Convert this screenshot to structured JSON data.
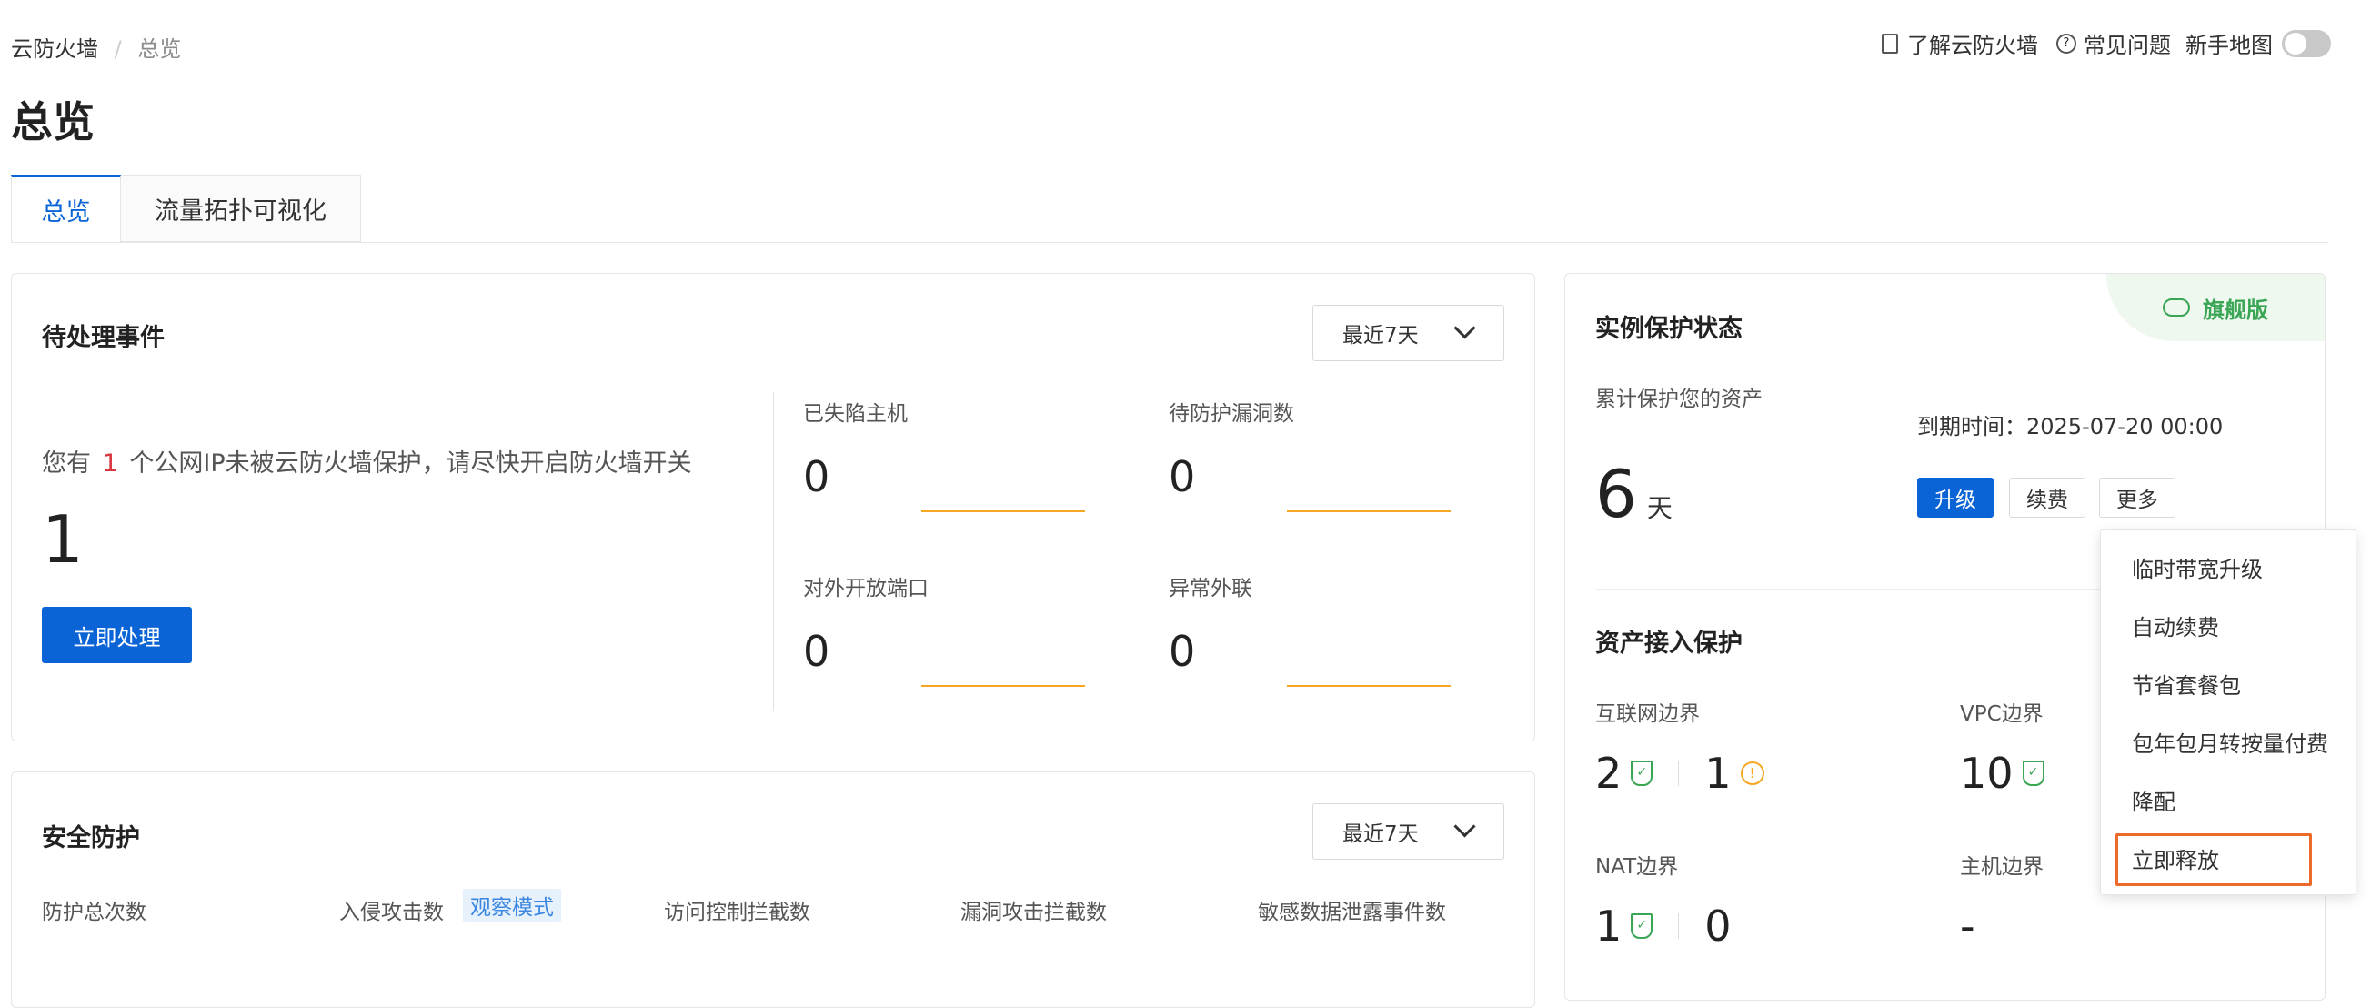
{
  "breadcrumb": {
    "root": "云防火墙",
    "separator": "/",
    "current": "总览"
  },
  "header_links": {
    "learn": "了解云防火墙",
    "faq": "常见问题",
    "guide": "新手地图",
    "guide_toggle_on": false
  },
  "page_title": "总览",
  "tabs": [
    {
      "label": "总览",
      "active": true
    },
    {
      "label": "流量拓扑可视化",
      "active": false
    }
  ],
  "pending": {
    "title": "待处理事件",
    "range": "最近7天",
    "message_prefix": "您有",
    "message_count": "1",
    "message_suffix": "个公网IP未被云防火墙保护，请尽快开启防火墙开关",
    "big_count": "1",
    "action": "立即处理",
    "metrics": [
      {
        "label": "已失陷主机",
        "value": "0"
      },
      {
        "label": "待防护漏洞数",
        "value": "0"
      },
      {
        "label": "对外开放端口",
        "value": "0"
      },
      {
        "label": "异常外联",
        "value": "0"
      }
    ]
  },
  "security": {
    "title": "安全防护",
    "range": "最近7天",
    "columns": [
      "防护总次数",
      "入侵攻击数",
      "访问控制拦截数",
      "漏洞攻击拦截数",
      "敏感数据泄露事件数"
    ],
    "badge": "观察模式"
  },
  "instance": {
    "title": "实例保护状态",
    "edition": "旗舰版",
    "cumulative_label": "累计保护您的资产",
    "days": "6",
    "days_unit": "天",
    "expiry_label": "到期时间：",
    "expiry_value": "2025-07-20 00:00",
    "buttons": {
      "upgrade": "升级",
      "renew": "续费",
      "more": "更多"
    }
  },
  "assets": {
    "title": "资产接入保护",
    "internet": {
      "label": "互联网边界",
      "protected": "2",
      "warning": "1"
    },
    "vpc": {
      "label": "VPC边界",
      "protected": "10"
    },
    "nat": {
      "label": "NAT边界",
      "protected": "1",
      "other": "0"
    },
    "host": {
      "label": "主机边界",
      "value": "-"
    }
  },
  "more_menu": [
    "临时带宽升级",
    "自动续费",
    "节省套餐包",
    "包年包月转按量付费",
    "降配",
    "立即释放"
  ],
  "colors": {
    "primary": "#0b64d6",
    "warning": "#f5a623",
    "success": "#3aa655",
    "danger": "#d9363e",
    "highlight_border": "#ee6a2a"
  }
}
